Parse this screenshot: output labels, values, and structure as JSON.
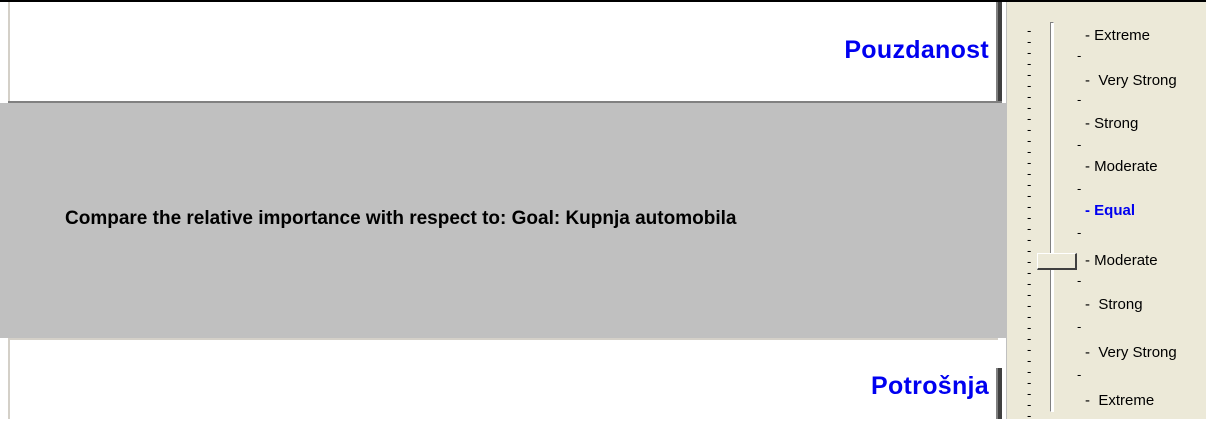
{
  "comparison": {
    "criterion_top": "Pouzdanost",
    "criterion_bottom": "Potrošnja",
    "question": "Compare the relative importance with respect to: Goal: Kupnja automobila"
  },
  "slider": {
    "selected_value": "Moderate",
    "selected_side": "Potrošnja",
    "labels": [
      "Extreme",
      "Very Strong",
      "Strong",
      "Moderate",
      "Equal",
      "Moderate",
      "Strong",
      "Very Strong",
      "Extreme"
    ]
  }
}
